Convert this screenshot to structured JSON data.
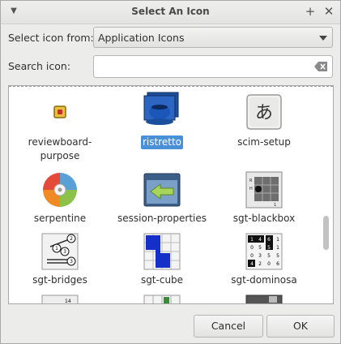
{
  "window": {
    "title": "Select An Icon"
  },
  "form": {
    "source_label": "Select icon from:",
    "source_value": "Application Icons",
    "search_label": "Search icon:",
    "search_value": ""
  },
  "icons": [
    {
      "label": "reviewboard-\npurpose",
      "icon": "reviewboard-icon"
    },
    {
      "label": "ristretto",
      "icon": "ristretto-icon",
      "selected": true
    },
    {
      "label": "scim-setup",
      "icon": "scim-icon",
      "glyph": "あ"
    },
    {
      "label": "serpentine",
      "icon": "serpentine-icon"
    },
    {
      "label": "session-properties",
      "icon": "session-properties-icon"
    },
    {
      "label": "sgt-blackbox",
      "icon": "blackbox-icon"
    },
    {
      "label": "sgt-bridges",
      "icon": "bridges-icon"
    },
    {
      "label": "sgt-cube",
      "icon": "cube-icon"
    },
    {
      "label": "sgt-dominosa",
      "icon": "dominosa-icon"
    }
  ],
  "buttons": {
    "cancel": "Cancel",
    "ok": "OK"
  }
}
